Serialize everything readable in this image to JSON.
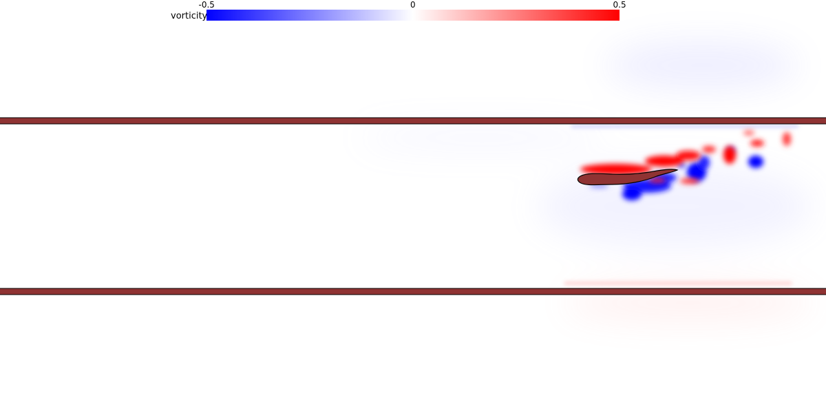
{
  "chart_data": {
    "type": "heatmap",
    "colorbar": {
      "title": "vorticity",
      "min": -0.5,
      "max": 0.5,
      "tick_labels": [
        "-0.5",
        "0",
        "0.5"
      ],
      "colors": {
        "negative": "#0000ff",
        "zero": "#ffffff",
        "positive": "#ff0000"
      }
    },
    "solid_color": "#8f3333"
  }
}
